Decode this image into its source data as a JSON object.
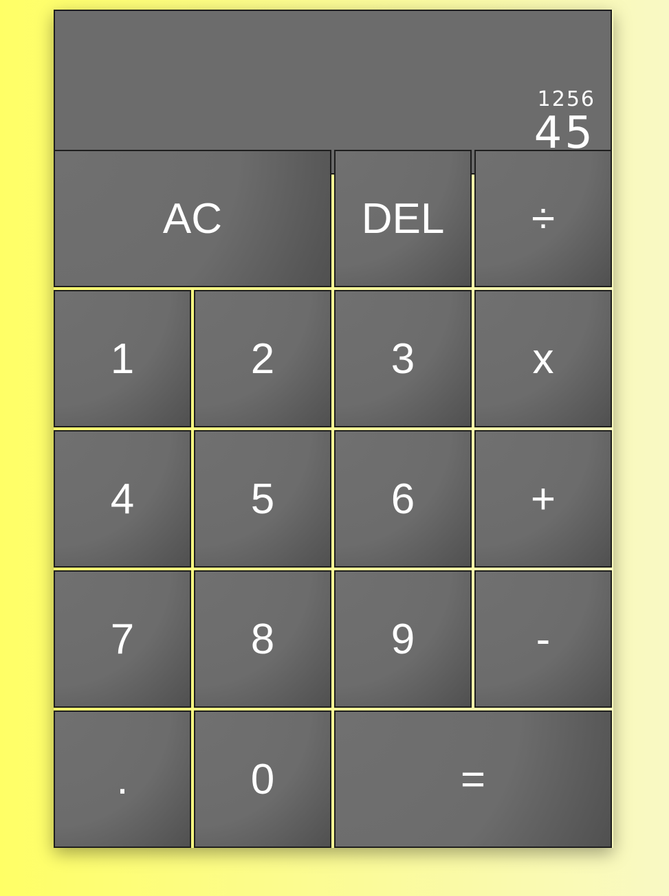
{
  "display": {
    "previous_operand": "1256",
    "current_operand": "45"
  },
  "keys": {
    "clear": "AC",
    "delete": "DEL",
    "divide": "÷",
    "one": "1",
    "two": "2",
    "three": "3",
    "multiply": "x",
    "four": "4",
    "five": "5",
    "six": "6",
    "add": "+",
    "seven": "7",
    "eight": "8",
    "nine": "9",
    "subtract": "-",
    "decimal": ".",
    "zero": "0",
    "equals": "="
  },
  "colors": {
    "background_left": "#ffff66",
    "background_right": "#f9f9c4",
    "key_fill": "#6c6c6c",
    "key_border": "#1e1e1e",
    "text": "#ffffff"
  }
}
